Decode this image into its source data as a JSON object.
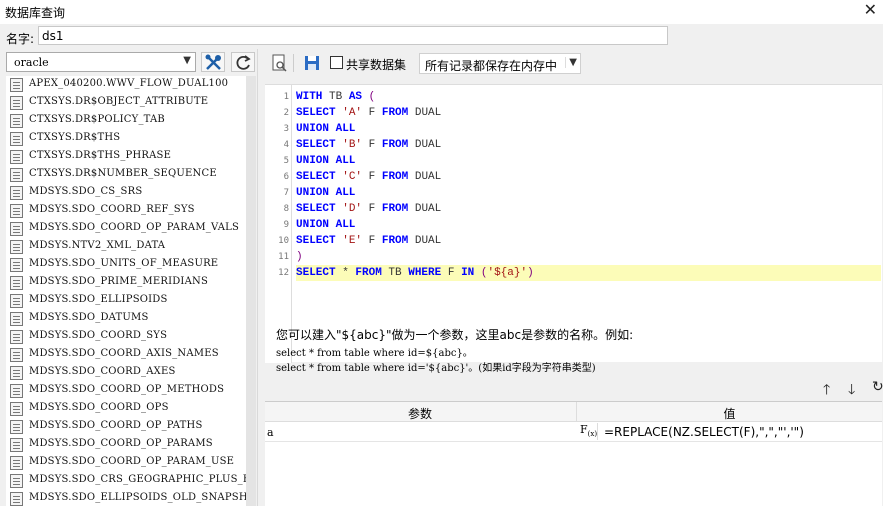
{
  "window": {
    "title": "数据库查询",
    "close_glyph": "✕"
  },
  "name_field": {
    "label": "名字:",
    "value": "ds1"
  },
  "left_panel": {
    "database": "oracle",
    "tables": [
      "APEX_040200.WWV_FLOW_DUAL100",
      "CTXSYS.DR$OBJECT_ATTRIBUTE",
      "CTXSYS.DR$POLICY_TAB",
      "CTXSYS.DR$THS",
      "CTXSYS.DR$THS_PHRASE",
      "CTXSYS.DR$NUMBER_SEQUENCE",
      "MDSYS.SDO_CS_SRS",
      "MDSYS.SDO_COORD_REF_SYS",
      "MDSYS.SDO_COORD_OP_PARAM_VALS",
      "MDSYS.NTV2_XML_DATA",
      "MDSYS.SDO_UNITS_OF_MEASURE",
      "MDSYS.SDO_PRIME_MERIDIANS",
      "MDSYS.SDO_ELLIPSOIDS",
      "MDSYS.SDO_DATUMS",
      "MDSYS.SDO_COORD_SYS",
      "MDSYS.SDO_COORD_AXIS_NAMES",
      "MDSYS.SDO_COORD_AXES",
      "MDSYS.SDO_COORD_OP_METHODS",
      "MDSYS.SDO_COORD_OPS",
      "MDSYS.SDO_COORD_OP_PATHS",
      "MDSYS.SDO_COORD_OP_PARAMS",
      "MDSYS.SDO_COORD_OP_PARAM_USE",
      "MDSYS.SDO_CRS_GEOGRAPHIC_PLUS_HEIGHT",
      "MDSYS.SDO_ELLIPSOIDS_OLD_SNAPSHOT"
    ]
  },
  "toolbar": {
    "share_label": "共享数据集",
    "share_checked": false,
    "mode_value": "所有记录都保存在内存中"
  },
  "editor": {
    "line_numbers": [
      "1",
      "2",
      "3",
      "4",
      "5",
      "6",
      "7",
      "8",
      "9",
      "10",
      "11",
      "12"
    ],
    "highlighted_line": 12,
    "lines": [
      [
        {
          "t": "WITH",
          "c": "kw"
        },
        {
          "t": " TB ",
          "c": "tbl"
        },
        {
          "t": "AS",
          "c": "kw"
        },
        {
          "t": " (",
          "c": "par"
        }
      ],
      [
        {
          "t": "SELECT",
          "c": "kw"
        },
        {
          "t": " ",
          "c": ""
        },
        {
          "t": "'A'",
          "c": "str"
        },
        {
          "t": " F ",
          "c": "tbl"
        },
        {
          "t": "FROM",
          "c": "kw"
        },
        {
          "t": " DUAL",
          "c": "tbl"
        }
      ],
      [
        {
          "t": "UNION ALL",
          "c": "kw"
        }
      ],
      [
        {
          "t": "SELECT",
          "c": "kw"
        },
        {
          "t": " ",
          "c": ""
        },
        {
          "t": "'B'",
          "c": "str"
        },
        {
          "t": " F ",
          "c": "tbl"
        },
        {
          "t": "FROM",
          "c": "kw"
        },
        {
          "t": " DUAL",
          "c": "tbl"
        }
      ],
      [
        {
          "t": "UNION ALL",
          "c": "kw"
        }
      ],
      [
        {
          "t": "SELECT",
          "c": "kw"
        },
        {
          "t": " ",
          "c": ""
        },
        {
          "t": "'C'",
          "c": "str"
        },
        {
          "t": " F ",
          "c": "tbl"
        },
        {
          "t": "FROM",
          "c": "kw"
        },
        {
          "t": " DUAL",
          "c": "tbl"
        }
      ],
      [
        {
          "t": "UNION ALL",
          "c": "kw"
        }
      ],
      [
        {
          "t": "SELECT",
          "c": "kw"
        },
        {
          "t": " ",
          "c": ""
        },
        {
          "t": "'D'",
          "c": "str"
        },
        {
          "t": " F ",
          "c": "tbl"
        },
        {
          "t": "FROM",
          "c": "kw"
        },
        {
          "t": " DUAL",
          "c": "tbl"
        }
      ],
      [
        {
          "t": "UNION ALL",
          "c": "kw"
        }
      ],
      [
        {
          "t": "SELECT",
          "c": "kw"
        },
        {
          "t": " ",
          "c": ""
        },
        {
          "t": "'E'",
          "c": "str"
        },
        {
          "t": " F ",
          "c": "tbl"
        },
        {
          "t": "FROM",
          "c": "kw"
        },
        {
          "t": " DUAL",
          "c": "tbl"
        }
      ],
      [
        {
          "t": ")",
          "c": "par"
        }
      ],
      [
        {
          "t": "SELECT",
          "c": "kw"
        },
        {
          "t": " * ",
          "c": "tbl"
        },
        {
          "t": "FROM",
          "c": "kw"
        },
        {
          "t": " TB ",
          "c": "tbl"
        },
        {
          "t": "WHERE",
          "c": "kw"
        },
        {
          "t": " F ",
          "c": "tbl"
        },
        {
          "t": "IN",
          "c": "kw"
        },
        {
          "t": " (",
          "c": "par"
        },
        {
          "t": "'${a}'",
          "c": "str"
        },
        {
          "t": ")",
          "c": "par"
        }
      ]
    ]
  },
  "hint": {
    "line1": "您可以建入\"${abc}\"做为一个参数，这里abc是参数的名称。例如:",
    "line2": "select * from table where id=${abc}。",
    "line3": "select * from table where id='${abc}'。(如果id字段为字符串类型)"
  },
  "param_table": {
    "col_param": "参数",
    "col_value": "值",
    "rows": [
      {
        "name": "a",
        "fx": "F",
        "fx_sub": "(x)",
        "value": "=REPLACE(NZ.SELECT(F),\",\",\"','\")"
      }
    ]
  },
  "colors": {
    "keyword": "#0000ff",
    "string": "#a31515",
    "paren": "#800080",
    "highlight_line": "#fcfcb8"
  }
}
